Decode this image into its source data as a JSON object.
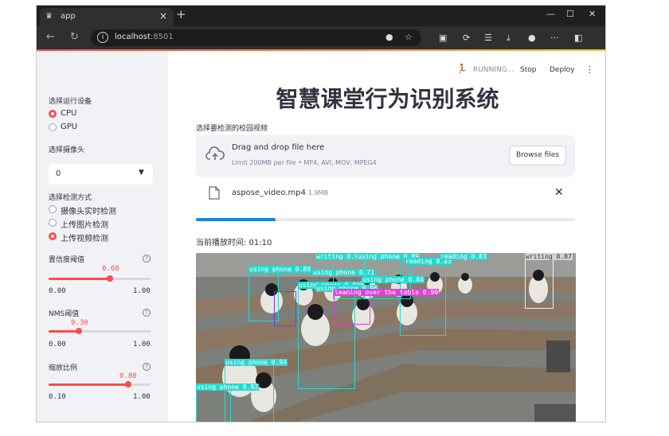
{
  "browser": {
    "tab_title": "app",
    "url_host": "localhost",
    "url_port": ":8501"
  },
  "topbar": {
    "status": "RUNNING...",
    "stop_label": "Stop",
    "deploy_label": "Deploy",
    "menu_icon": "⋮"
  },
  "sidebar": {
    "device_label": "选择运行设备",
    "device_options": [
      "CPU",
      "GPU"
    ],
    "device_selected": 0,
    "camera_label": "选择摄像头",
    "camera_value": "0",
    "method_label": "选择检测方式",
    "method_options": [
      "摄像头实时检测",
      "上传图片检测",
      "上传视频检测"
    ],
    "method_selected": 2,
    "conf": {
      "label": "置信度阈值",
      "value": "0.60",
      "min": "0.00",
      "max": "1.00",
      "fraction": 0.6
    },
    "nms": {
      "label": "NMS阈值",
      "value": "0.30",
      "min": "0.00",
      "max": "1.00",
      "fraction": 0.3
    },
    "scale": {
      "label": "缩放比例",
      "value": "0.80",
      "min": "0.10",
      "max": "1.00",
      "fraction": 0.78
    }
  },
  "main": {
    "title": "智慧课堂行为识别系统",
    "upload_label": "选择要检测的校园视频",
    "drag_text": "Drag and drop file here",
    "limit_text": "Limit 200MB per file • MP4, AVI, MOV, MPEG4",
    "browse_label": "Browse files",
    "file_name": "aspose_video.mp4",
    "file_size": "1.9MB",
    "progress_fraction": 0.21,
    "playtime_label": "当前播放时间: 01:10"
  },
  "detections": [
    "writing 0.90",
    "using phone 0.89",
    "reading 0.85",
    "reading 0.83",
    "writing 0.87",
    "using phone 0.89",
    "using phone 0.71",
    "using phone 0.84",
    "using phone 0.90",
    "using phone 0.96",
    "leaning over the table 0.90",
    "using phone 0.94",
    "using phone 0.92"
  ]
}
